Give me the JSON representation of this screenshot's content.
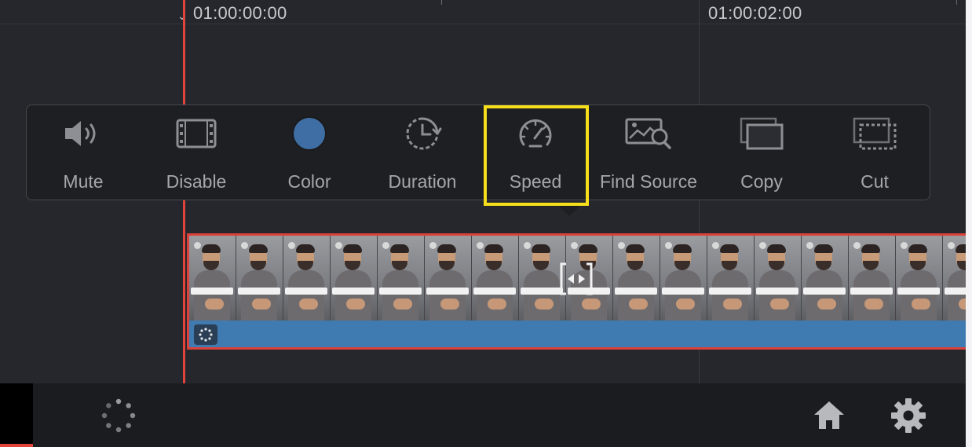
{
  "timeline": {
    "timecodes": [
      "01:00:00:00",
      "01:00:02:00"
    ]
  },
  "toolbar": {
    "items": [
      {
        "label": "Mute",
        "icon": "speaker-icon"
      },
      {
        "label": "Disable",
        "icon": "film-frame-icon"
      },
      {
        "label": "Color",
        "icon": "color-dot-icon",
        "color": "#3e6ea3"
      },
      {
        "label": "Duration",
        "icon": "clock-duration-icon"
      },
      {
        "label": "Speed",
        "icon": "speedometer-icon",
        "highlighted": true
      },
      {
        "label": "Find Source",
        "icon": "find-source-icon"
      },
      {
        "label": "Copy",
        "icon": "copy-icon"
      },
      {
        "label": "Cut",
        "icon": "cut-icon"
      }
    ],
    "highlight_color": "#f6de1b"
  },
  "clip": {
    "border_color": "#d9413a",
    "audio_color": "#3f7ab0",
    "thumbnail_count": 17
  },
  "bottom_bar": {
    "icons": [
      "activity-spinner-icon",
      "home-icon",
      "settings-gear-icon"
    ]
  },
  "colors": {
    "background": "#26272c",
    "playhead": "#e2433b",
    "panel": "#1e1f23"
  }
}
